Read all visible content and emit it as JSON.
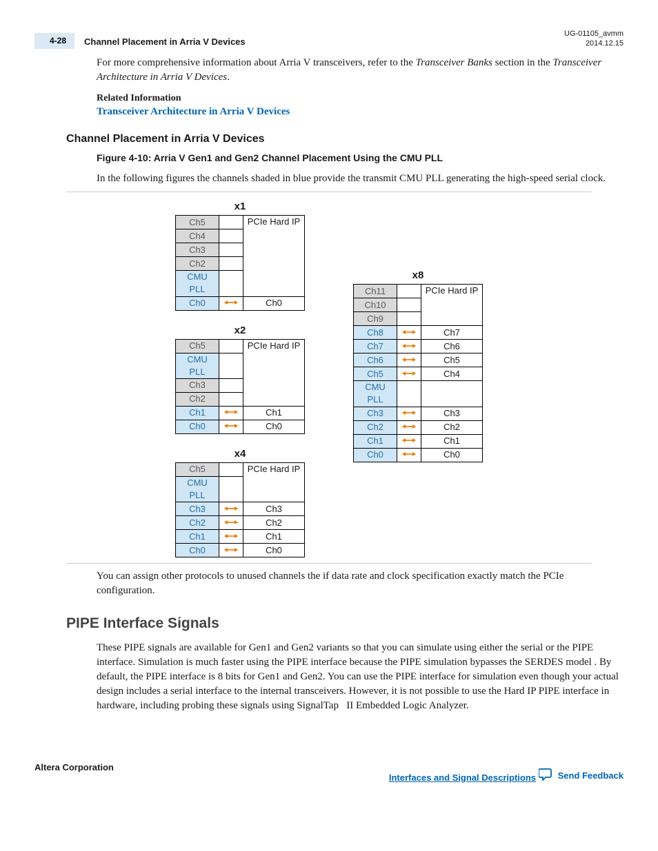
{
  "header": {
    "page_badge": "4-28",
    "title": "Channel Placement in Arria V Devices",
    "doc_id": "UG-01105_avmm",
    "date": "2014.12.15"
  },
  "intro_para": "For more comprehensive information about Arria V transceivers, refer to the ",
  "intro_em1": "Transceiver Banks",
  "intro_mid": " section in the ",
  "intro_em2": "Transceiver Architecture in Arria V Devices",
  "intro_end": ".",
  "related_label": "Related Information",
  "related_link": "Transceiver Architecture in Arria V Devices",
  "section_heading": "Channel Placement in Arria V Devices",
  "figure_caption": "Figure 4-10: Arria V Gen1 and Gen2 Channel Placement Using the CMU PLL",
  "figure_intro": "In the following figures the channels shaded in blue provide the transmit CMU PLL generating the high-speed serial clock.",
  "ip_label": "PCIe Hard IP",
  "figures": {
    "x1": {
      "title": "x1",
      "rows": [
        {
          "l": "Ch5",
          "lcls": "gray",
          "r": "PCIe Hard IP",
          "ip": "top"
        },
        {
          "l": "Ch4",
          "lcls": "gray",
          "ip": "cont"
        },
        {
          "l": "Ch3",
          "lcls": "gray",
          "ip": "cont"
        },
        {
          "l": "Ch2",
          "lcls": "gray",
          "ip": "cont"
        },
        {
          "l": "CMU PLL",
          "lcls": "blue",
          "ip": "last"
        },
        {
          "l": "Ch0",
          "lcls": "blue",
          "arrow": true,
          "r": "Ch0"
        }
      ]
    },
    "x2": {
      "title": "x2",
      "rows": [
        {
          "l": "Ch5",
          "lcls": "gray",
          "r": "PCIe Hard IP",
          "ip": "top"
        },
        {
          "l": "CMU PLL",
          "lcls": "blue",
          "ip": "cont"
        },
        {
          "l": "Ch3",
          "lcls": "gray",
          "ip": "cont"
        },
        {
          "l": "Ch2",
          "lcls": "gray",
          "ip": "last"
        },
        {
          "l": "Ch1",
          "lcls": "blue",
          "arrow": true,
          "r": "Ch1"
        },
        {
          "l": "Ch0",
          "lcls": "blue",
          "arrow": true,
          "r": "Ch0"
        }
      ]
    },
    "x4": {
      "title": "x4",
      "rows": [
        {
          "l": "Ch5",
          "lcls": "gray",
          "r": "PCIe Hard IP",
          "ip": "top"
        },
        {
          "l": "CMU PLL",
          "lcls": "blue",
          "ip": "last"
        },
        {
          "l": "Ch3",
          "lcls": "blue",
          "arrow": true,
          "r": "Ch3"
        },
        {
          "l": "Ch2",
          "lcls": "blue",
          "arrow": true,
          "r": "Ch2"
        },
        {
          "l": "Ch1",
          "lcls": "blue",
          "arrow": true,
          "r": "Ch1"
        },
        {
          "l": "Ch0",
          "lcls": "blue",
          "arrow": true,
          "r": "Ch0"
        }
      ]
    },
    "x8": {
      "title": "x8",
      "rows": [
        {
          "l": "Ch11",
          "lcls": "gray",
          "r": "PCIe Hard IP",
          "ip": "top"
        },
        {
          "l": "Ch10",
          "lcls": "gray",
          "ip": "cont"
        },
        {
          "l": "Ch9",
          "lcls": "gray",
          "ip": "last"
        },
        {
          "l": "Ch8",
          "lcls": "blue",
          "arrow": true,
          "r": "Ch7"
        },
        {
          "l": "Ch7",
          "lcls": "blue",
          "arrow": true,
          "r": "Ch6"
        },
        {
          "l": "Ch6",
          "lcls": "blue",
          "arrow": true,
          "r": "Ch5"
        },
        {
          "l": "Ch5",
          "lcls": "blue",
          "arrow": true,
          "r": "Ch4"
        },
        {
          "l": "CMU PLL",
          "lcls": "blue",
          "r": "",
          "empty": true
        },
        {
          "l": "Ch3",
          "lcls": "blue",
          "arrow": true,
          "r": "Ch3"
        },
        {
          "l": "Ch2",
          "lcls": "blue",
          "arrow": true,
          "r": "Ch2"
        },
        {
          "l": "Ch1",
          "lcls": "blue",
          "arrow": true,
          "r": "Ch1"
        },
        {
          "l": "Ch0",
          "lcls": "blue",
          "arrow": true,
          "r": "Ch0"
        }
      ]
    }
  },
  "after_fig": "You can assign other protocols to unused channels the if data rate and clock specification exactly match the PCIe configuration.",
  "pipe_heading": "PIPE Interface Signals",
  "pipe_para": "These PIPE signals are available for Gen1 and Gen2 variants so that you can simulate using either the serial or the PIPE interface. Simulation is much faster using the PIPE interface because the PIPE simulation bypasses the SERDES model . By default, the PIPE interface is 8 bits for Gen1 and Gen2. You can use the PIPE interface for simulation even though your actual design includes a serial interface to the internal transceivers. However, it is not possible to use the Hard IP PIPE interface in hardware, including probing these signals using SignalTap   II Embedded Logic Analyzer.",
  "footer": {
    "left": "Altera Corporation",
    "right_link": "Interfaces and Signal Descriptions",
    "feedback": "Send Feedback"
  }
}
